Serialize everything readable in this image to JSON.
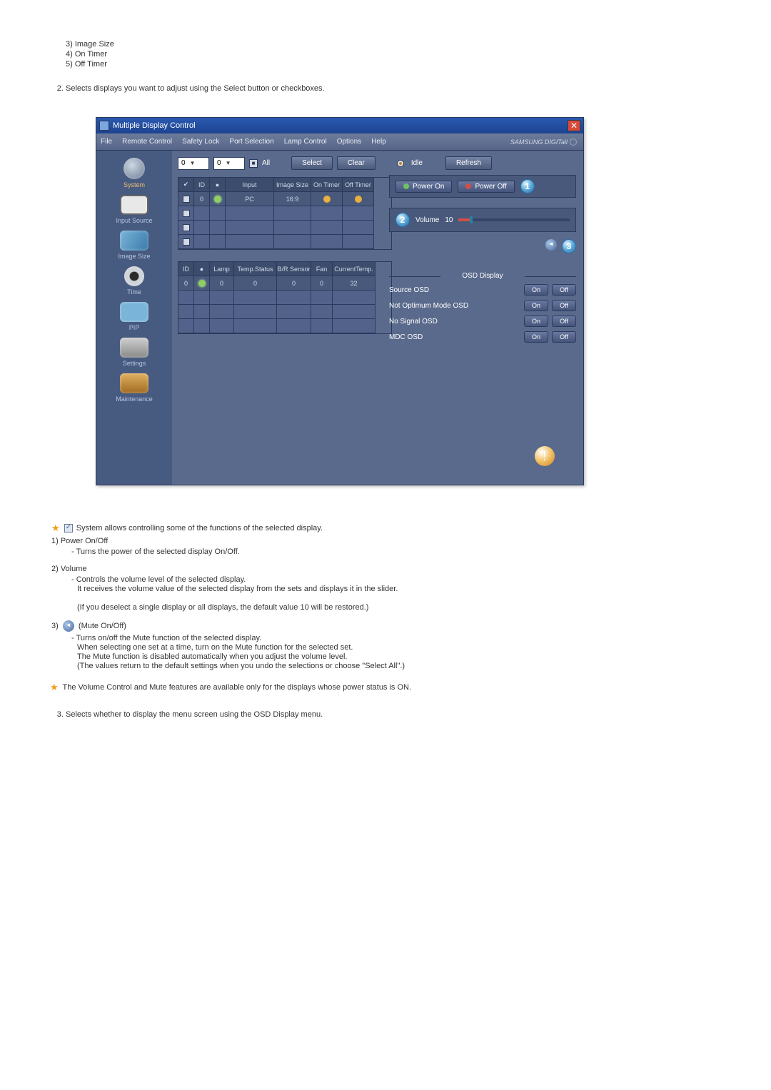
{
  "top_list": {
    "item3": "3) Image Size",
    "item4": "4) On Timer",
    "item5": "5) Off Timer"
  },
  "top_step2": "Selects displays you want to adjust using the Select button or checkboxes.",
  "app": {
    "title": "Multiple Display Control",
    "menu": [
      "File",
      "Remote Control",
      "Safety Lock",
      "Port Selection",
      "Lamp Control",
      "Options",
      "Help"
    ],
    "brand": "SAMSUNG DIGITall"
  },
  "sidebar": [
    {
      "label": "System"
    },
    {
      "label": "Input Source"
    },
    {
      "label": "Image Size"
    },
    {
      "label": "Time"
    },
    {
      "label": "PIP"
    },
    {
      "label": "Settings"
    },
    {
      "label": "Maintenance"
    }
  ],
  "toolbar": {
    "sel1": "0",
    "sel2": "0",
    "all": "All",
    "select": "Select",
    "clear": "Clear",
    "idle": "Idle",
    "refresh": "Refresh"
  },
  "table1": {
    "headers": [
      "",
      "ID",
      "",
      "Input",
      "Image Size",
      "On Timer",
      "Off Timer"
    ],
    "row0": {
      "id": "0",
      "input": "PC",
      "size": "16:9"
    }
  },
  "table2": {
    "headers": [
      "ID",
      "",
      "Lamp",
      "Temp.Status",
      "B/R Sensor",
      "Fan",
      "CurrentTemp."
    ],
    "row0": {
      "id": "0",
      "lamp": "0",
      "temp": "0",
      "br": "0",
      "fan": "0",
      "cur": "32"
    }
  },
  "right": {
    "power_on": "Power On",
    "power_off": "Power Off",
    "callouts": {
      "c1": "1",
      "c2": "2",
      "c3": "3"
    },
    "volume_label": "Volume",
    "volume_value": "10",
    "osd_title": "OSD Display",
    "osd_rows": [
      {
        "label": "Source OSD"
      },
      {
        "label": "Not Optimum Mode OSD"
      },
      {
        "label": "No Signal OSD"
      },
      {
        "label": "MDC OSD"
      }
    ],
    "on": "On",
    "off": "Off"
  },
  "expl": {
    "lead": " System allows controlling some of the functions of the selected display.",
    "i1_title": "1)  Power On/Off",
    "i1_b1": "- Turns the power of the selected display On/Off.",
    "i2_title": "2)  Volume",
    "i2_b1": "- Controls the volume level of the selected display.",
    "i2_b2": "It receives the volume value of the selected display from the sets and displays it in the slider.",
    "i2_b3": "(If you deselect a single display or all displays, the default value 10 will be restored.)",
    "i3_title": "3)",
    "i3_paren": " (Mute On/Off)",
    "i3_b1": "- Turns on/off the Mute function of the selected display.",
    "i3_b2": "When selecting one set at a time, turn on the Mute function for the selected set.",
    "i3_b3": "The Mute function is disabled automatically when you adjust the volume level.",
    "i3_b4": "(The values return to the default settings when you undo the selections or choose \"Select All\".)",
    "note": " The Volume Control and Mute features are available only for the displays whose power status is ON.",
    "step3": "Selects whether to display the menu screen using the OSD Display menu."
  }
}
